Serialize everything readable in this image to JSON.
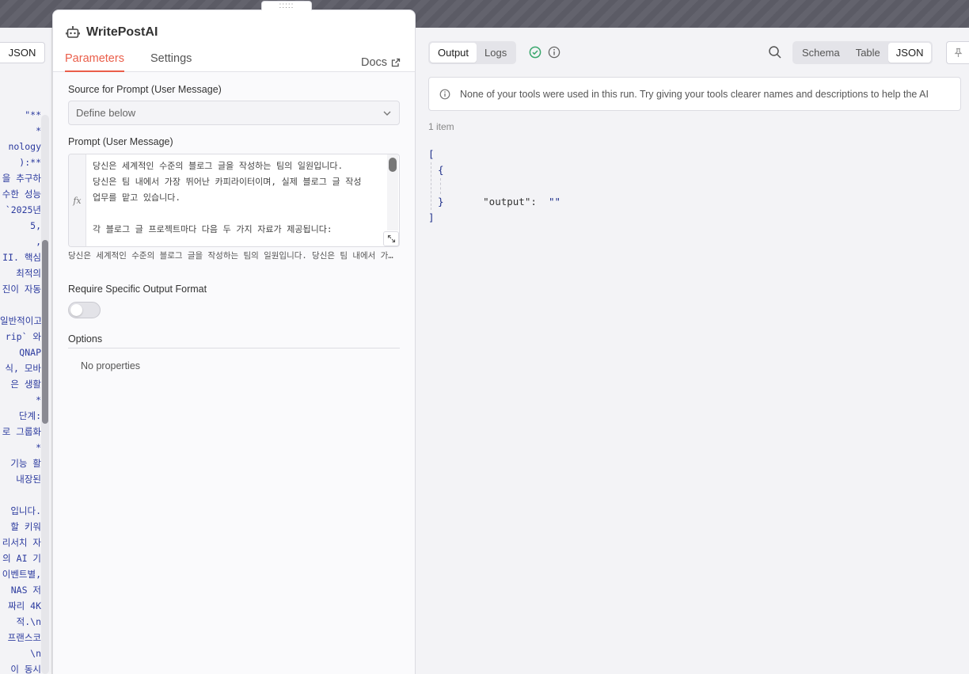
{
  "node": {
    "title": "WritePostAI",
    "tabs": [
      "Parameters",
      "Settings"
    ],
    "docs_label": "Docs",
    "drag_handle": ":::::"
  },
  "left_pane": {
    "json_button": "JSON",
    "lines": [
      "\"**",
      "*",
      "nology",
      "):**",
      "을 추구하",
      "수한 성능",
      "`2025년",
      "5,",
      ",",
      "II. 핵심",
      " 최적의",
      "진이 자동",
      "",
      "일반적이고",
      "rip` 와",
      " QNAP",
      "식, 모바",
      "은 생활",
      "*",
      "단계:",
      "로 그룹화",
      "*",
      " 기능 활",
      "내장된",
      "",
      "입니다.",
      "할 키워",
      "리서치 자",
      "의 AI 기",
      "이벤트별,",
      " NAS 저",
      "짜리 4K",
      "적.\\n",
      "프랜스코",
      "\\n",
      "이 동시"
    ]
  },
  "parameters": {
    "source_label": "Source for Prompt (User Message)",
    "source_value": "Define below",
    "prompt_label": "Prompt (User Message)",
    "fx_label": "fx",
    "prompt_lines": [
      "당신은 세계적인 수준의 블로그 글을 작성하는 팀의 일원입니다.",
      "당신은 팀 내에서 가장 뛰어난 카피라이터이며, 실제 블로그 글 작성",
      "업무를 맡고 있습니다.",
      "",
      "각 블로그 글 프로젝트마다 다음 두 가지 자료가 제공됩니다:"
    ],
    "prompt_preview": "당신은 세계적인 수준의 블로그 글을 작성하는 팀의 일원입니다. 당신은 팀 내에서 가장 뛰어난 카피라이터이며, 실제 블로그 글 작성 업무를 맡고 있습니다.",
    "output_format_label": "Require Specific Output Format",
    "output_format_enabled": false,
    "options_label": "Options",
    "no_properties": "No properties"
  },
  "output": {
    "tabs": [
      "Output",
      "Logs"
    ],
    "active_tab": "Output",
    "view_modes": [
      "Schema",
      "Table",
      "JSON"
    ],
    "active_view": "JSON",
    "notice": "None of your tools were used in this run. Try giving your tools clearer names and descriptions to help the AI",
    "item_count": "1 item",
    "json": {
      "open_bracket": "[",
      "open_brace": "{",
      "key": "\"output\"",
      "colon": ":",
      "value": "\"\"",
      "close_brace": "}",
      "close_bracket": "]"
    }
  },
  "colors": {
    "accent": "#ea5e4a",
    "success": "#3aa76d",
    "json_blue": "#1e2f8a"
  }
}
